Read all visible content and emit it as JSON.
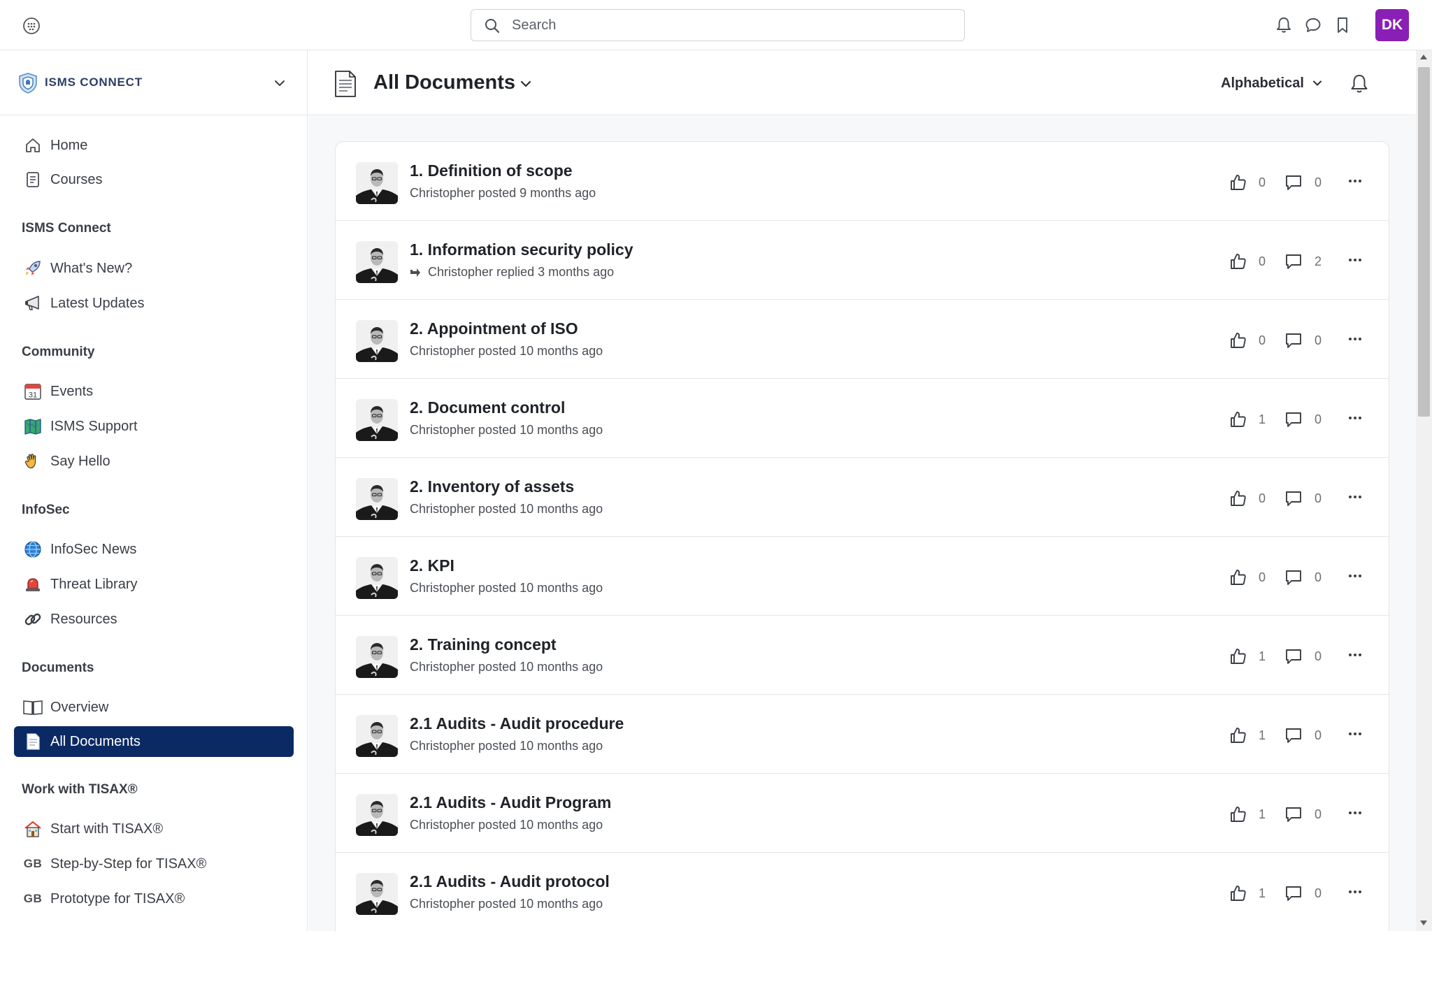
{
  "topbar": {
    "search_placeholder": "Search",
    "avatar_initials": "DK",
    "avatar_color": "#8a1fb5",
    "icons": [
      "app-grid-icon",
      "search-icon",
      "bell-icon",
      "chat-icon",
      "bookmark-icon"
    ]
  },
  "sidebar": {
    "brand": "ISMS CONNECT",
    "home_items": [
      {
        "label": "Home",
        "icon": "home-icon"
      },
      {
        "label": "Courses",
        "icon": "courses-icon"
      }
    ],
    "sections": [
      {
        "title": "ISMS Connect",
        "items": [
          {
            "label": "What's New?",
            "icon": "rocket-icon"
          },
          {
            "label": "Latest Updates",
            "icon": "megaphone-icon"
          }
        ]
      },
      {
        "title": "Community",
        "items": [
          {
            "label": "Events",
            "icon": "calendar-icon",
            "icon_text": "31"
          },
          {
            "label": "ISMS Support",
            "icon": "map-icon"
          },
          {
            "label": "Say Hello",
            "icon": "wave-icon"
          }
        ]
      },
      {
        "title": "InfoSec",
        "items": [
          {
            "label": "InfoSec News",
            "icon": "globe-icon"
          },
          {
            "label": "Threat Library",
            "icon": "siren-icon"
          },
          {
            "label": "Resources",
            "icon": "link-icon"
          }
        ]
      },
      {
        "title": "Documents",
        "items": [
          {
            "label": "Overview",
            "icon": "book-icon"
          },
          {
            "label": "All Documents",
            "icon": "document-icon",
            "active": true
          }
        ]
      },
      {
        "title": "Work with TISAX®",
        "items": [
          {
            "label": "Start with TISAX®",
            "icon": "house-icon"
          },
          {
            "label": "Step-by-Step for TISAX®",
            "icon": "flag-gb-icon",
            "icon_text": "GB"
          },
          {
            "label": "Prototype for TISAX®",
            "icon": "flag-gb-icon",
            "icon_text": "GB"
          }
        ]
      }
    ],
    "active_color": "#0b2a63"
  },
  "main": {
    "title": "All Documents",
    "sort_label": "Alphabetical",
    "posts": [
      {
        "title": "1. Definition of scope",
        "meta": "Christopher posted 9 months ago",
        "reply": false,
        "likes": "0",
        "comments": "0"
      },
      {
        "title": "1. Information security policy",
        "meta": "Christopher replied 3 months ago",
        "reply": true,
        "likes": "0",
        "comments": "2"
      },
      {
        "title": "2. Appointment of ISO",
        "meta": "Christopher posted 10 months ago",
        "reply": false,
        "likes": "0",
        "comments": "0"
      },
      {
        "title": "2. Document control",
        "meta": "Christopher posted 10 months ago",
        "reply": false,
        "likes": "1",
        "comments": "0"
      },
      {
        "title": "2. Inventory of assets",
        "meta": "Christopher posted 10 months ago",
        "reply": false,
        "likes": "0",
        "comments": "0"
      },
      {
        "title": "2. KPI",
        "meta": "Christopher posted 10 months ago",
        "reply": false,
        "likes": "0",
        "comments": "0"
      },
      {
        "title": "2. Training concept",
        "meta": "Christopher posted 10 months ago",
        "reply": false,
        "likes": "1",
        "comments": "0"
      },
      {
        "title": "2.1 Audits - Audit procedure",
        "meta": "Christopher posted 10 months ago",
        "reply": false,
        "likes": "1",
        "comments": "0"
      },
      {
        "title": "2.1 Audits - Audit Program",
        "meta": "Christopher posted 10 months ago",
        "reply": false,
        "likes": "1",
        "comments": "0"
      },
      {
        "title": "2.1 Audits - Audit protocol",
        "meta": "Christopher posted 10 months ago",
        "reply": false,
        "likes": "1",
        "comments": "0"
      }
    ]
  }
}
